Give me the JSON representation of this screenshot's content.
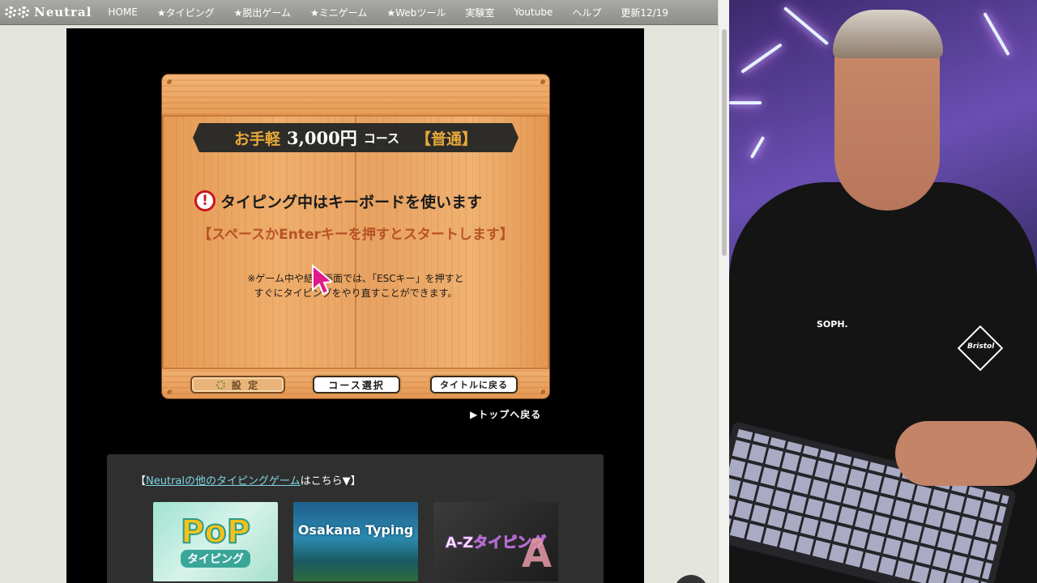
{
  "nav": {
    "logo_text": "Neutral",
    "items": [
      {
        "label": "HOME"
      },
      {
        "label": "★タイピング"
      },
      {
        "label": "★脱出ゲーム"
      },
      {
        "label": "★ミニゲーム"
      },
      {
        "label": "★Webツール"
      },
      {
        "label": "実験室"
      },
      {
        "label": "Youtube"
      },
      {
        "label": "ヘルプ"
      },
      {
        "label": "更新12/19"
      }
    ]
  },
  "game": {
    "course": {
      "prefix": "お手軽",
      "price": "3,000円",
      "suffix": "コース",
      "level": "【普通】"
    },
    "warning_icon": "exclamation-icon",
    "warning_text": "タイピング中はキーボードを使います",
    "start_text": "【スペースかEnterキーを押すとスタートします】",
    "note_line1": "※ゲーム中や結果画面では、「ESCキー」を押すと",
    "note_line2": "すぐにタイピングをやり直すことができます。",
    "buttons": {
      "settings": "設 定",
      "course_select": "コース選択",
      "back_to_title": "タイトルに戻る"
    },
    "back_to_top": "▶トップへ戻る"
  },
  "other_games": {
    "prefix": "【",
    "link": "Neutralの他のタイピングゲーム",
    "suffix": "はこちら▼】",
    "thumbs": [
      {
        "line1": "PoP",
        "line2": "タイピング"
      },
      {
        "line1": "Osakana Typing"
      },
      {
        "line1": "A-Zタイピング",
        "line2": "A"
      }
    ]
  },
  "webcam": {
    "shirt_brand": "SOPH.",
    "shirt_logo": "Bristol"
  },
  "colors": {
    "accent_gold": "#e7a93a",
    "start_text": "#b24a20",
    "link": "#7fd6e6",
    "warning_red": "#c8161d"
  }
}
